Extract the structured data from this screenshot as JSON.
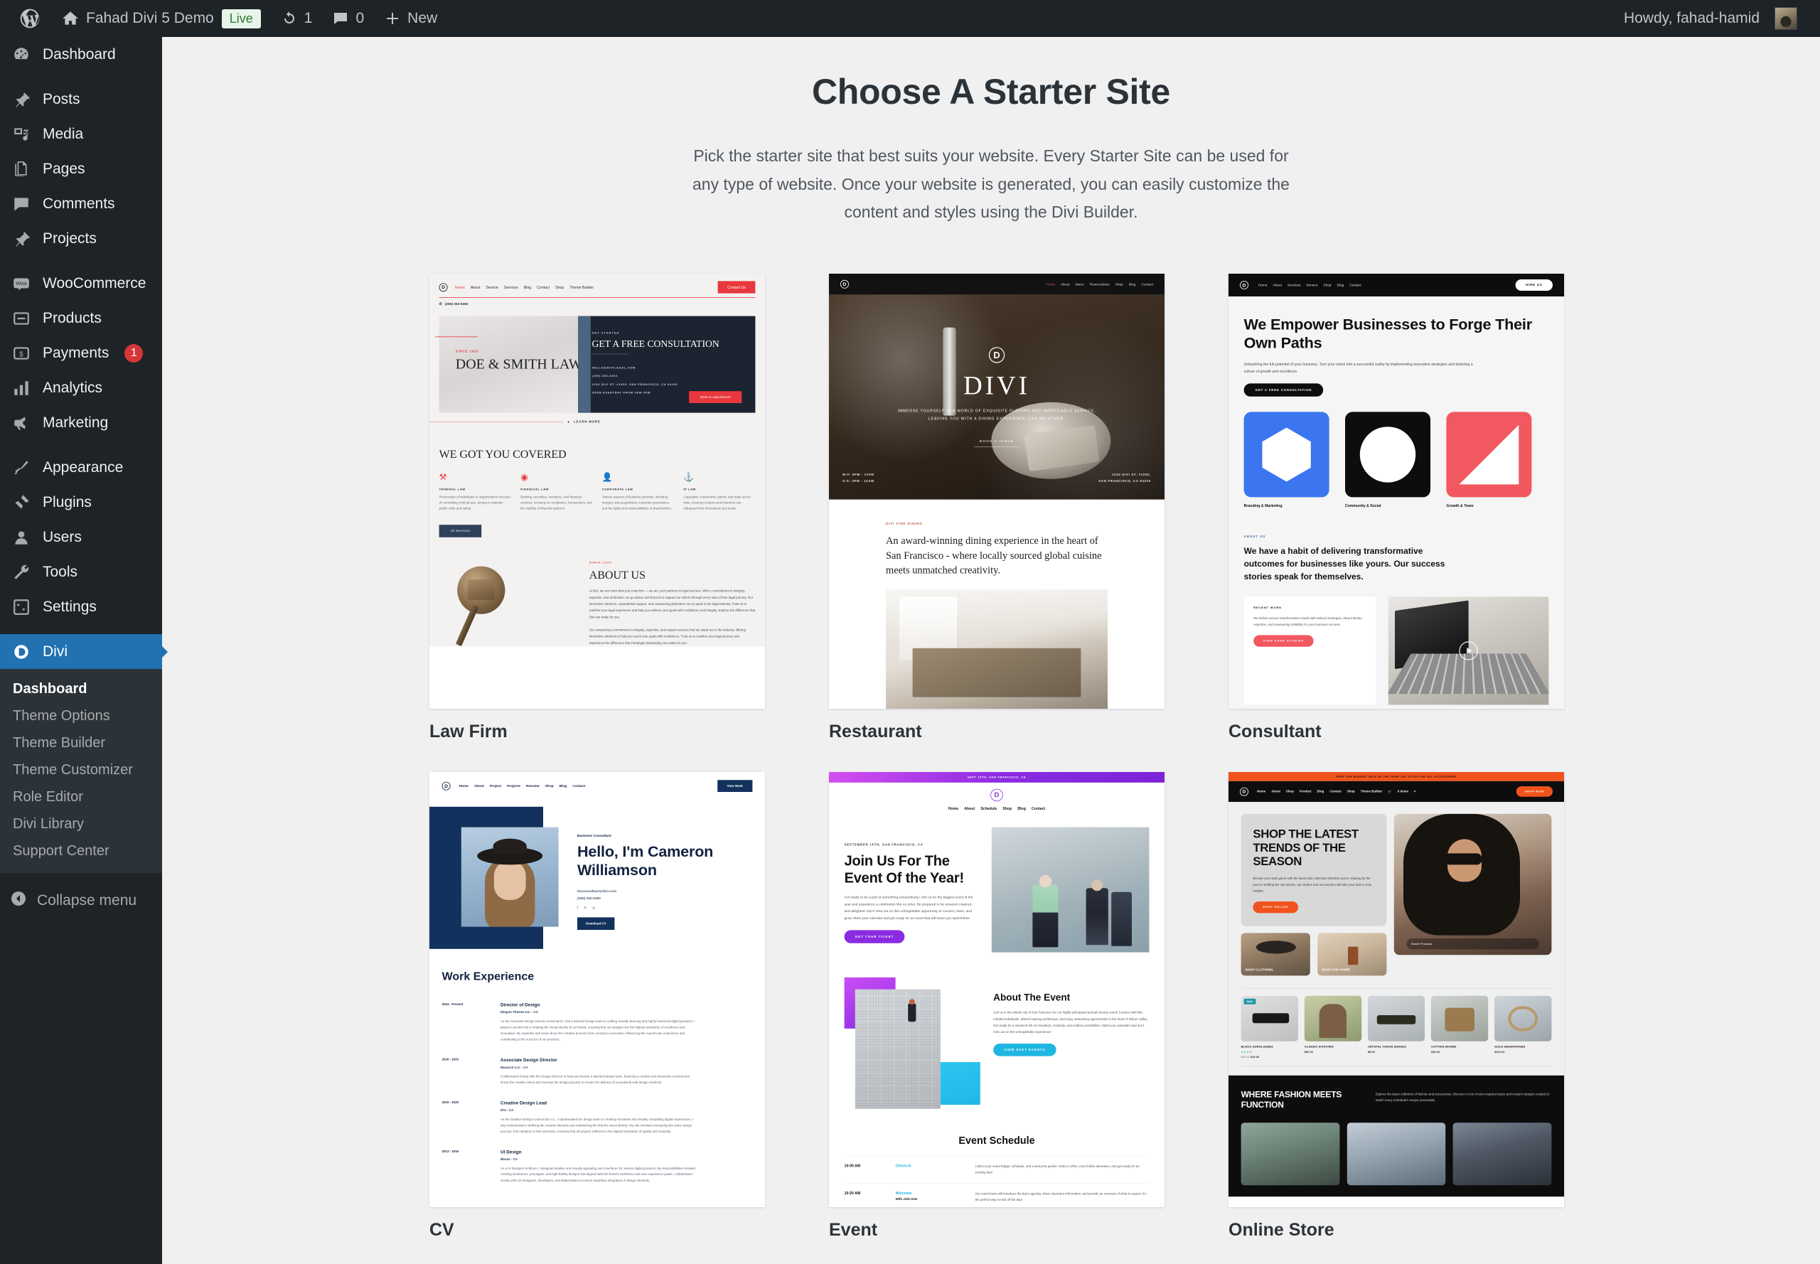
{
  "adminbar": {
    "wp_logo": "wordpress-logo",
    "site_name": "Fahad Divi 5 Demo",
    "live_badge": "Live",
    "updates_count": "1",
    "comments_count": "0",
    "new_label": "New",
    "howdy": "Howdy, fahad-hamid"
  },
  "sidebar": {
    "items": [
      {
        "label": "Dashboard",
        "icon": "dashboard-icon"
      },
      {
        "label": "Posts",
        "icon": "pin-icon"
      },
      {
        "label": "Media",
        "icon": "media-icon"
      },
      {
        "label": "Pages",
        "icon": "pages-icon"
      },
      {
        "label": "Comments",
        "icon": "comment-icon"
      },
      {
        "label": "Projects",
        "icon": "pin-icon"
      },
      {
        "label": "WooCommerce",
        "icon": "woo-icon"
      },
      {
        "label": "Products",
        "icon": "products-icon"
      },
      {
        "label": "Payments",
        "icon": "payments-icon",
        "badge": "1"
      },
      {
        "label": "Analytics",
        "icon": "analytics-icon"
      },
      {
        "label": "Marketing",
        "icon": "megaphone-icon"
      },
      {
        "label": "Appearance",
        "icon": "appearance-icon"
      },
      {
        "label": "Plugins",
        "icon": "plugins-icon"
      },
      {
        "label": "Users",
        "icon": "users-icon"
      },
      {
        "label": "Tools",
        "icon": "tools-icon"
      },
      {
        "label": "Settings",
        "icon": "settings-icon"
      },
      {
        "label": "Divi",
        "icon": "divi-icon",
        "current": true
      }
    ],
    "submenu": [
      {
        "label": "Dashboard",
        "current": true
      },
      {
        "label": "Theme Options"
      },
      {
        "label": "Theme Builder"
      },
      {
        "label": "Theme Customizer"
      },
      {
        "label": "Role Editor"
      },
      {
        "label": "Divi Library"
      },
      {
        "label": "Support Center"
      }
    ],
    "collapse": "Collapse menu"
  },
  "page": {
    "title": "Choose A Starter Site",
    "description": "Pick the starter site that best suits your website. Every Starter Site can be used for any type of website. Once your website is generated, you can easily customize the content and styles using the Divi Builder."
  },
  "cards": [
    {
      "title": "Law Firm"
    },
    {
      "title": "Restaurant"
    },
    {
      "title": "Consultant"
    },
    {
      "title": "CV"
    },
    {
      "title": "Event"
    },
    {
      "title": "Online Store"
    }
  ],
  "lawfirm": {
    "nav": [
      "Home",
      "About",
      "Service",
      "Services",
      "Blog",
      "Contact",
      "Shop",
      "Theme Builder"
    ],
    "cta": "Contact Us",
    "phone": "(255) 352-6392",
    "since": "SINCE 1923",
    "name": "DOE & SMITH LAW",
    "kicker": "GET STARTED",
    "heading": "GET A FREE CONSULTATION",
    "email": "HELLO@DIVILEGAL.COM",
    "phone2": "(255) 352-6392",
    "address": "1234 DIVI ST. #1000, SAN FRANCISCO, CA 94220",
    "hours": "OPEN EVERYDAY FROM 9AM-5PM",
    "book_btn": "Book An Appointment",
    "learn_more": "LEARN MORE",
    "section_title": "WE GOT YOU COVERED",
    "features": [
      {
        "icon": "gavel-icon",
        "title": "CRIMINAL LAW",
        "desc": "Prosecution of individuals or organizations accused of committing criminal acts, aiming to maintain public order and safety."
      },
      {
        "icon": "coins-icon",
        "title": "FINANCIAL LAW",
        "desc": "Banking, securities, insurance, and financial services, focusing on compliance, transactions, and the stability of financial systems."
      },
      {
        "icon": "person-icon",
        "title": "CORPORATE LAW",
        "desc": "Various aspects of business activities, including mergers and acquisitions, corporate governance, and the rights and responsibilities of shareholders."
      },
      {
        "icon": "ip-icon",
        "title": "IP LAW",
        "desc": "Copyrights, trademarks, patent, and trade secret laws, ensuring creators and inventors can safeguard their innovations and works."
      }
    ],
    "all_services": "All Services",
    "about_kicker": "SINCE 1923",
    "about_title": "ABOUT US",
    "about_p1": "At Divi, we are more than just a law firm — we are your partners in legal success. With a commitment to integrity, expertise, and dedication, we go above and beyond to support our clients through every step of their legal journey. Our innovative solutions, unparalleled support, and unwavering dedication set us apart in the legal industry. Trust us to redefine your legal experience and help you achieve your goals with confidence and integrity. Explore the difference that Divi can make for you.",
    "about_p2": "Our unwavering commitment to integrity, expertise, and support ensures that we stand out in the industry, offering innovative solutions to help you reach your goals with confidence. Trust us to redefine your legal journey and experience the difference that Paralegal Onboarding can make for you."
  },
  "restaurant": {
    "nav": [
      "Home",
      "About",
      "Menu",
      "Reservations",
      "Shop",
      "Blog",
      "Contact"
    ],
    "title": "DIVI",
    "tagline": "IMMERSE YOURSELF IN A WORLD OF EXQUISITE FLAVORS AND IMPECCABLE SERVICE, LEAVING YOU WITH A DINING EXPERIENCE LIKE NO OTHER.",
    "book": "BOOK A TABLE",
    "hours": "M-F: 5PM - 11PM\nS-S: 3PM - 12AM",
    "address": "1234 DIVI ST. #1000,\nSAN FRANCISCO, CA 94220",
    "kicker": "DIVI FINE DINING",
    "paragraph": "An award-winning dining experience in the heart of San Francisco - where locally sourced global cuisine meets unmatched creativity."
  },
  "consultant": {
    "nav": [
      "Home",
      "About",
      "Services",
      "Service",
      "Shop",
      "Blog",
      "Contact"
    ],
    "hire": "HIRE US",
    "heading": "We Empower Businesses to Forge Their Own Paths",
    "paragraph": "Unleashing the full potential of your business. Turn your vision into a successful reality by implementing innovative strategies and fostering a culture of growth and excellence.",
    "cta": "GET A FREE CONSULTATION",
    "cards": [
      {
        "label": "Branding & Marketing",
        "shape": "hexagon",
        "color": "#3b76f0"
      },
      {
        "label": "Community & Social",
        "shape": "circle",
        "color": "#0d0d0d"
      },
      {
        "label": "Growth & Team",
        "shape": "triangle",
        "color": "#f2585f"
      }
    ],
    "about_kicker": "ABOUT US",
    "about_heading": "We have a habit of delivering transformative outcomes for businesses like yours. Our success stories speak for themselves.",
    "work_kicker": "RECENT WORK",
    "work_p": "We deliver proven transformative results with tailored strategies, deep industry expertise, and unwavering reliability for your business success.",
    "work_btn": "VIEW CASE STUDIES"
  },
  "cv": {
    "nav": [
      "Home",
      "About",
      "Project",
      "Projects",
      "Resume",
      "Shop",
      "Blog",
      "Contact"
    ],
    "view_work": "View Work",
    "role": "Business Consultant",
    "heading": "Hello, I'm Cameron Williamson",
    "email": "bizconsultant@divi.com",
    "phone": "(255) 352-6393",
    "download": "Download CV",
    "work_title": "Work Experience",
    "jobs": [
      {
        "years": "2024 - Present",
        "title": "Director of Design",
        "company": "Elegant Themes Inc. - CA",
        "desc": "As the Associate Design Director at Monarch, I led a talented design team in crafting visually stunning and highly functional digital products. I played a pivotal role in shaping the visual identity of our brand, ensuring that our designs met the highest standards of excellence and innovation. My expertise and vision drove the creative process from concept to execution, influencing the overall user experience and contributing to the success of our products."
      },
      {
        "years": "2020 - 2023",
        "title": "Associate Design Director",
        "company": "Monarch LLC - CA",
        "desc": "Collaborated closely with the Design Director to lead and mentor a talented design team, fostering a creative and innovative environment. Drove the creative vision and oversaw the design process to ensure the delivery of exceptional web design solutions."
      },
      {
        "years": "2015 - 2020",
        "title": "Creative Design Lead",
        "company": "Divi - CA",
        "desc": "As the Creative Design Lead at Divi Co., I spearheaded the design team in creating innovative and visually compelling digital experiences. I was instrumental in defining the creative direction and maintaining the brand's visual identity. My role involved overseeing the entire design process, from ideation to final execution, ensuring that all projects adhered to the highest standards of quality and creativity."
      },
      {
        "years": "2013 - 2015",
        "title": "UI Design",
        "company": "Bloom - CA",
        "desc": "As a UI Designer at Bloom, I designed intuitive and visually appealing user interfaces for various digital products. My responsibilities included creating wireframes, prototypes, and high-fidelity designs that aligned with the brand's aesthetics and user experience goals. I collaborated closely with UX designers, developers, and stakeholders to ensure seamless integration of design elements."
      }
    ]
  },
  "event": {
    "topbar": "SEPT 15TH, SAN FRANCISCO, CA",
    "nav": [
      "Home",
      "About",
      "Schedule",
      "Shop",
      "Blog",
      "Contact"
    ],
    "kicker": "SEPTEMBER 15TH, SAN FRANCISCO, CA",
    "heading": "Join Us For The Event Of the Year!",
    "paragraph": "Get ready to be a part of something extraordinary! Join us for the biggest event of the year and experience a celebration like no other. Be prepared to be amazed, inspired, and delighted. Don't miss out on this unforgettable opportunity to connect, learn, and grow. Mark your calendar and get ready for an event that will leave you speechless.",
    "ticket_btn": "GET YOUR TICKET",
    "about_heading": "About The Event",
    "about_p": "Join us in the vibrant city of San Francisco for our highly anticipated annual meetup event! Connect with like-minded individuals, attend inspiring workshops, and enjoy networking opportunities in the heart of Silicon Valley. Get ready for a weekend full of innovation, creativity, and endless possibilities. Mark your calendars and don't miss out on this unforgettable experience!",
    "past_btn": "VIEW PAST EVENTS",
    "schedule_title": "Event Schedule",
    "schedule": [
      {
        "time": "10:00 AM",
        "name": "Check-In",
        "sub": "",
        "desc": "Collect your event badge, schedule, and a welcome packet. Grab a coffee, meet fellow attendees, and get ready for an exciting day!"
      },
      {
        "time": "10:20 AM",
        "name": "Welcome",
        "sub": "With John Doe",
        "desc": "Our event hosts will introduce the day's agenda, share important information, and provide an overview of what to expect. It's the perfect way to kick off the day!"
      }
    ]
  },
  "store": {
    "topbar": "SHOP OUR BIGGEST SALE OF THE YEAR! GET 15-30% OFF ALL ACCESSORIES",
    "nav": [
      "Home",
      "About",
      "Shop",
      "Product",
      "Blog",
      "Contact",
      "Shop",
      "Theme Builder"
    ],
    "cart": "0 Items",
    "shop_now": "SHOP NOW",
    "heading": "SHOP THE LATEST TRENDS OF THE SEASON",
    "paragraph": "Elevate your style game with the latest Divi collection! Whether you're relaxing by the pool or strolling the city streets, our clothes and accessories will take your look to new heights.",
    "shop_online": "SHOP ONLINE",
    "mini": [
      {
        "label": "SHOP CLOTHING"
      },
      {
        "label": "SHOP FOR HOME"
      }
    ],
    "search_placeholder": "Search Products",
    "products": [
      {
        "name": "BLACK SUNGLASSES",
        "price": "$19.00",
        "old": "$22.00",
        "sale": "Sale!",
        "stars": "★★★★"
      },
      {
        "name": "CLASSIC AVIATORS",
        "price": "$60.00",
        "old": "",
        "sale": "",
        "stars": ""
      },
      {
        "name": "CRYSTAL VISION SHADES",
        "price": "$8.00",
        "old": "",
        "sale": "",
        "stars": ""
      },
      {
        "name": "CUTTING BOARD",
        "price": "$45.00",
        "old": "",
        "sale": "",
        "stars": ""
      },
      {
        "name": "GOLD HEADPHONES",
        "price": "$210.00",
        "old": "",
        "sale": "",
        "stars": ""
      }
    ],
    "dark_heading": "WHERE FASHION MEETS FUNCTION",
    "dark_p": "Explore the latest collection of fashion and accessories. Discover a mix of retro-inspired styles and modern designs created to match every individual's unique personality."
  }
}
